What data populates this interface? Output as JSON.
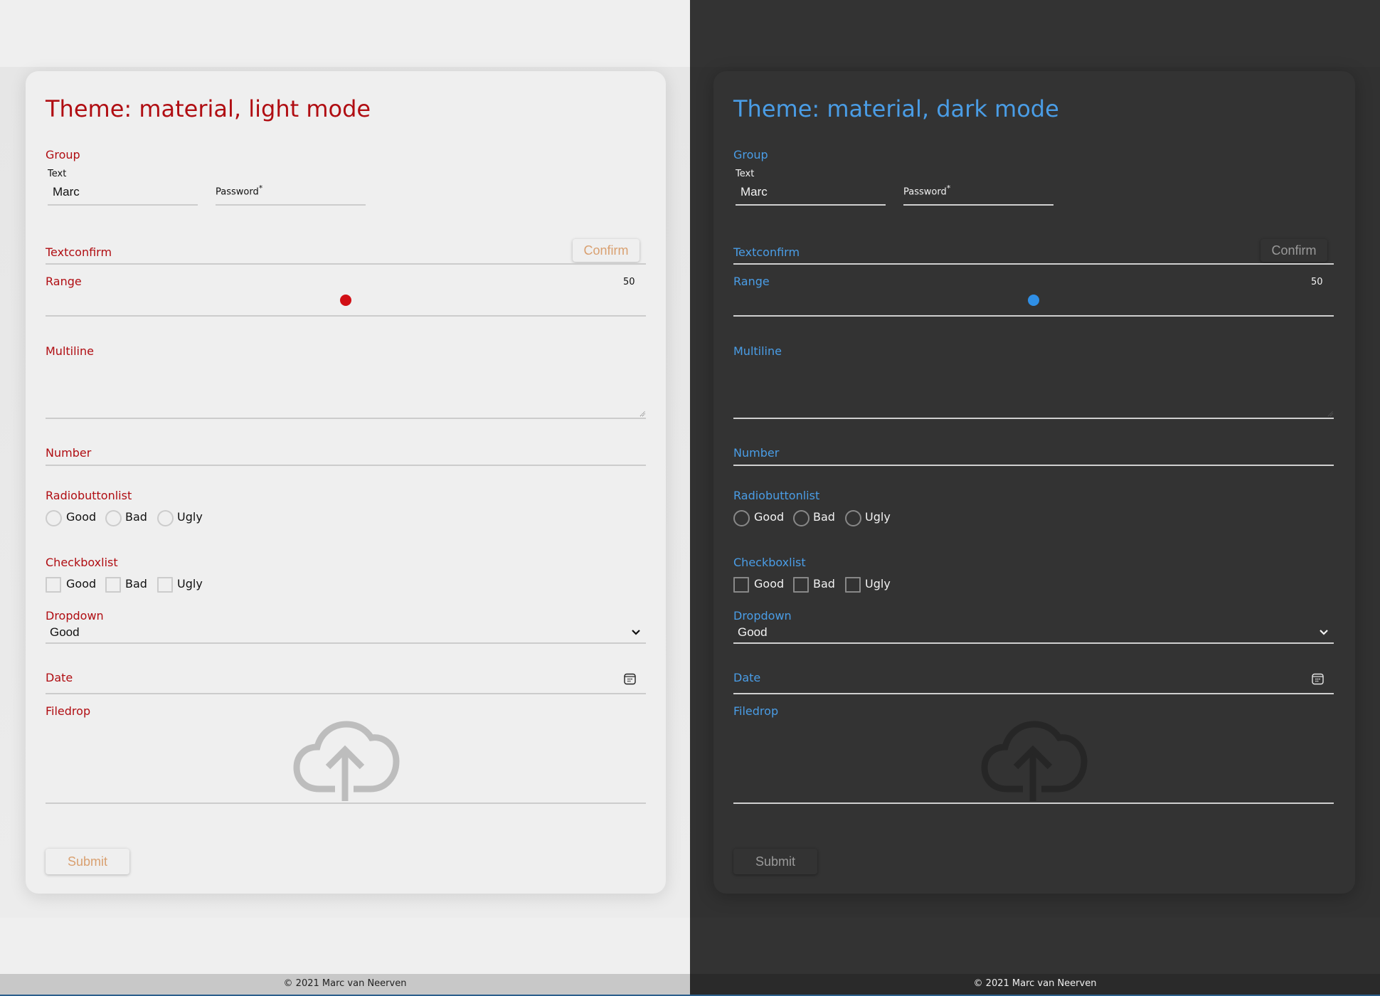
{
  "panels": [
    {
      "mode": "light",
      "title": "Theme: material, light mode",
      "accent_color": "#b00d12",
      "group": {
        "label": "Group",
        "text": {
          "label": "Text",
          "value": "Marc"
        },
        "password": {
          "label": "Password",
          "required_marker": "*",
          "value": ""
        }
      },
      "textconfirm": {
        "label": "Textconfirm",
        "value": "",
        "confirm_label": "Confirm"
      },
      "range": {
        "label": "Range",
        "value": "50",
        "fraction": 0.5
      },
      "multiline": {
        "label": "Multiline",
        "value": ""
      },
      "number": {
        "label": "Number",
        "value": ""
      },
      "radiobuttonlist": {
        "label": "Radiobuttonlist",
        "options": [
          "Good",
          "Bad",
          "Ugly"
        ],
        "selected": null
      },
      "checkboxlist": {
        "label": "Checkboxlist",
        "options": [
          "Good",
          "Bad",
          "Ugly"
        ],
        "checked": []
      },
      "dropdown": {
        "label": "Dropdown",
        "selected": "Good"
      },
      "date": {
        "label": "Date",
        "value": "",
        "icon": "calendar-icon"
      },
      "filedrop": {
        "label": "Filedrop",
        "icon": "cloud-upload-icon"
      },
      "submit_label": "Submit",
      "footer": "© 2021 Marc van Neerven"
    },
    {
      "mode": "dark",
      "title": "Theme: material, dark mode",
      "accent_color": "#4a9de6",
      "group": {
        "label": "Group",
        "text": {
          "label": "Text",
          "value": "Marc"
        },
        "password": {
          "label": "Password",
          "required_marker": "*",
          "value": ""
        }
      },
      "textconfirm": {
        "label": "Textconfirm",
        "value": "",
        "confirm_label": "Confirm"
      },
      "range": {
        "label": "Range",
        "value": "50",
        "fraction": 0.5
      },
      "multiline": {
        "label": "Multiline",
        "value": ""
      },
      "number": {
        "label": "Number",
        "value": ""
      },
      "radiobuttonlist": {
        "label": "Radiobuttonlist",
        "options": [
          "Good",
          "Bad",
          "Ugly"
        ],
        "selected": null
      },
      "checkboxlist": {
        "label": "Checkboxlist",
        "options": [
          "Good",
          "Bad",
          "Ugly"
        ],
        "checked": []
      },
      "dropdown": {
        "label": "Dropdown",
        "selected": "Good"
      },
      "date": {
        "label": "Date",
        "value": "",
        "icon": "calendar-icon"
      },
      "filedrop": {
        "label": "Filedrop",
        "icon": "cloud-upload-icon"
      },
      "submit_label": "Submit",
      "footer": "© 2021 Marc van Neerven"
    }
  ]
}
